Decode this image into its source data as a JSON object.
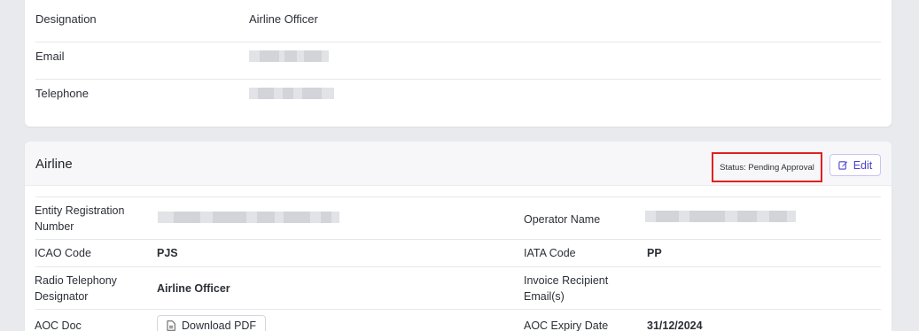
{
  "contact": {
    "rows": [
      {
        "label": "Designation",
        "value": "Airline Officer"
      },
      {
        "label": "Email",
        "value": ""
      },
      {
        "label": "Telephone",
        "value": ""
      }
    ]
  },
  "airline": {
    "title": "Airline",
    "status": "Status: Pending Approval",
    "edit_label": "Edit",
    "fields": {
      "entity_registration_label": "Entity Registration Number",
      "operator_name_label": "Operator Name",
      "icao_label": "ICAO Code",
      "icao_value": "PJS",
      "iata_label": "IATA Code",
      "iata_value": "PP",
      "radio_label": "Radio Telephony Designator",
      "radio_value": "Airline Officer",
      "invoice_label": "Invoice Recipient Email(s)",
      "aoc_doc_label": "AOC Doc",
      "download_label": "Download PDF",
      "aoc_expiry_label": "AOC Expiry Date",
      "aoc_expiry_value": "31/12/2024"
    }
  },
  "colors": {
    "accent": "#4b3fd1",
    "highlight": "#e02020",
    "background": "#e9eaee"
  }
}
